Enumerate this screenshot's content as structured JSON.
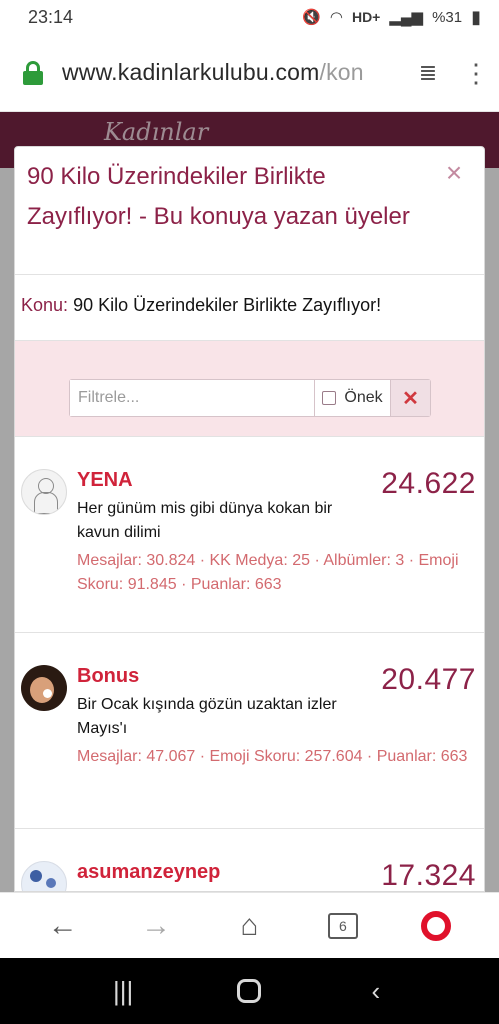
{
  "status_bar": {
    "time": "23:14",
    "network": "HD+",
    "battery": "%31"
  },
  "browser": {
    "url_main": "www.kadinlarkulubu.com",
    "url_rest": "/kon",
    "tab_count": "6"
  },
  "site": {
    "logo": "Kadınlar"
  },
  "modal": {
    "title": "90 Kilo Üzerindekiler Birlikte Zayıflıyor! - Bu konuya yazan üyeler",
    "close_symbol": "×",
    "topic_label": "Konu:",
    "topic_title": "90 Kilo Üzerindekiler Birlikte Zayıflıyor!",
    "filter_placeholder": "Filtrele...",
    "prefix_label": "Önek",
    "clear_symbol": "✕",
    "members": [
      {
        "name": "YENA",
        "title": "Her günüm mis gibi dünya kokan bir kavun dilimi",
        "stats": "Mesajlar: 30.824 · KK Medya: 25 · Albümler: 3 · Emoji Skoru: 91.845 · Puanlar: 663",
        "score": "24.622"
      },
      {
        "name": "Bonus",
        "title": "Bir Ocak kışında gözün uzaktan izler Mayıs'ı",
        "stats": "Mesajlar: 47.067 · Emoji Skoru: 257.604 · Puanlar: 663",
        "score": "20.477"
      },
      {
        "name": "asumanzeynep",
        "score": "17.324"
      }
    ]
  },
  "icons": {
    "back": "back-arrow-icon",
    "forward": "forward-arrow-icon",
    "home": "home-icon",
    "tabs": "tabs-icon",
    "opera": "opera-icon"
  },
  "colors": {
    "brand": "#7a2545",
    "accent_text": "#8c2248",
    "name_red": "#d0233a",
    "stats_red": "#d36a6f",
    "filter_bg": "#f9e4e8"
  }
}
